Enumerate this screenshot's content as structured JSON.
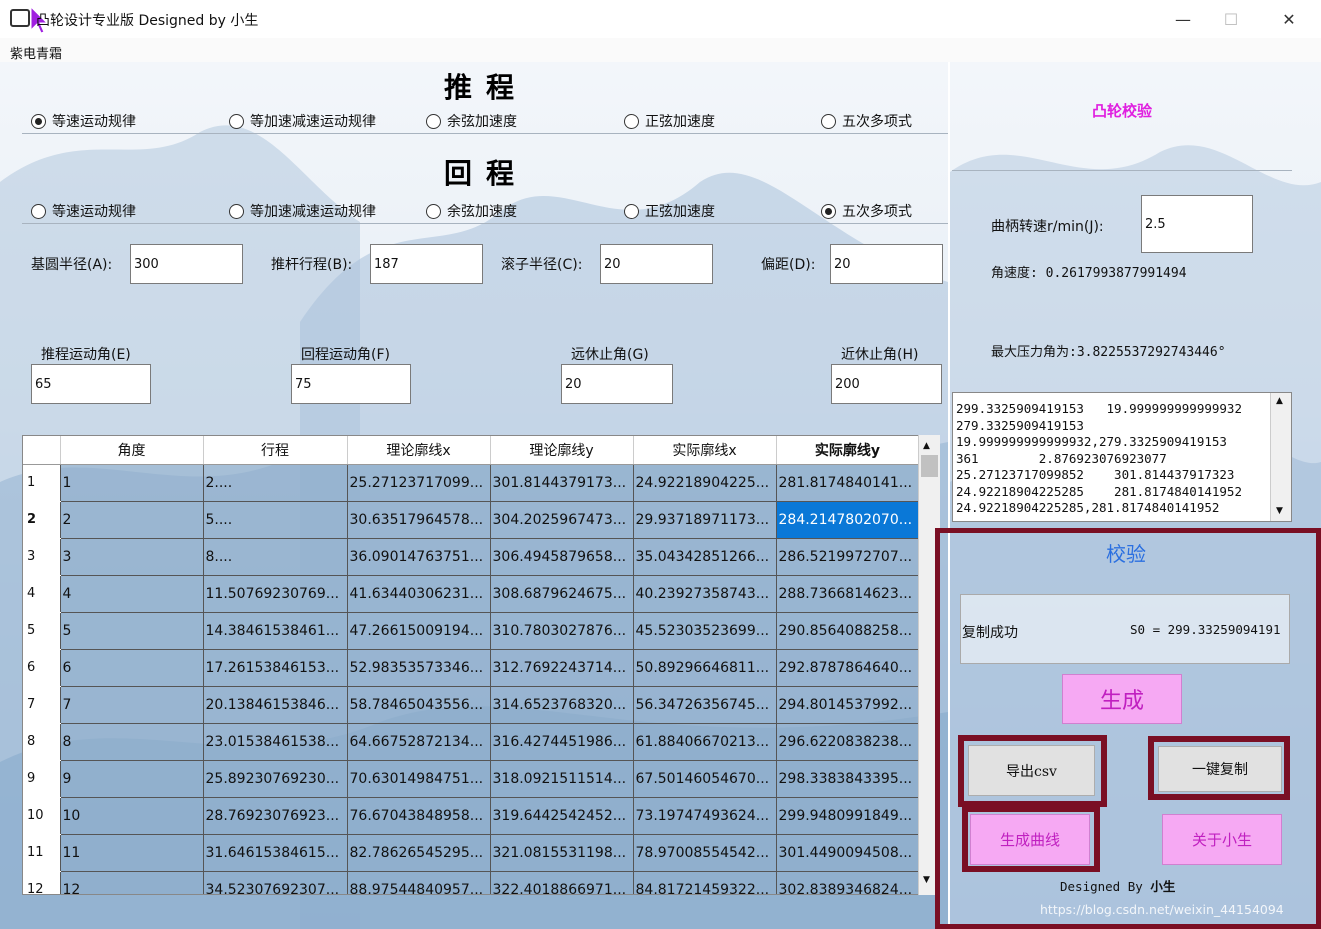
{
  "window": {
    "title": "凸轮设计专业版  Designed by 小生",
    "minimize": "—",
    "maximize": "☐",
    "close": "✕"
  },
  "menu": {
    "item": "紫电青霜"
  },
  "push": {
    "heading": "推程",
    "options": [
      "等速运动规律",
      "等加速减速运动规律",
      "余弦加速度",
      "正弦加速度",
      "五次多项式"
    ],
    "selected": 0
  },
  "return": {
    "heading": "回程",
    "options": [
      "等速运动规律",
      "等加速减速运动规律",
      "余弦加速度",
      "正弦加速度",
      "五次多项式"
    ],
    "selected": 4
  },
  "params": {
    "base_radius": {
      "label": "基圆半径(A):",
      "value": "300"
    },
    "stroke": {
      "label": "推杆行程(B):",
      "value": "187"
    },
    "roller_radius": {
      "label": "滚子半径(C):",
      "value": "20"
    },
    "offset": {
      "label": "偏距(D):",
      "value": "20"
    },
    "push_angle": {
      "label": "推程运动角(E)",
      "value": "65"
    },
    "return_angle": {
      "label": "回程运动角(F)",
      "value": "75"
    },
    "near_dwell": {
      "label": "远休止角(G)",
      "value": "20"
    },
    "far_dwell": {
      "label": "近休止角(H)",
      "value": "200"
    }
  },
  "table": {
    "columns": [
      "角度",
      "行程",
      "理论廓线x",
      "理论廓线y",
      "实际廓线x",
      "实际廓线y"
    ],
    "rows": [
      [
        "1",
        "1",
        "2....",
        "25.27123717099...",
        "301.8144379173...",
        "24.92218904225...",
        "281.8174840141..."
      ],
      [
        "2",
        "2",
        "5....",
        "30.63517964578...",
        "304.2025967473...",
        "29.93718971173...",
        "284.2147802070..."
      ],
      [
        "3",
        "3",
        "8....",
        "36.09014763751...",
        "306.4945879658...",
        "35.04342851266...",
        "286.5219972707..."
      ],
      [
        "4",
        "4",
        "11.50769230769...",
        "41.63440306231...",
        "308.6879624675...",
        "40.23927358743...",
        "288.7366814623..."
      ],
      [
        "5",
        "5",
        "14.38461538461...",
        "47.26615009194...",
        "310.7803027876...",
        "45.52303523699...",
        "290.8564088258..."
      ],
      [
        "6",
        "6",
        "17.26153846153...",
        "52.98353573346...",
        "312.7692243714...",
        "50.89296646811...",
        "292.8787864640..."
      ],
      [
        "7",
        "7",
        "20.13846153846...",
        "58.78465043556...",
        "314.6523768320...",
        "56.34726356745...",
        "294.8014537992..."
      ],
      [
        "8",
        "8",
        "23.01538461538...",
        "64.66752872134...",
        "316.4274451986...",
        "61.88406670213...",
        "296.6220838238..."
      ],
      [
        "9",
        "9",
        "25.89230769230...",
        "70.63014984751...",
        "318.0921511514...",
        "67.50146054670...",
        "298.3383843395..."
      ],
      [
        "10",
        "10",
        "28.76923076923...",
        "76.67043848958...",
        "319.6442542452...",
        "73.19747493624...",
        "299.9480991849..."
      ],
      [
        "11",
        "11",
        "31.64615384615...",
        "82.78626545295...",
        "321.0815531198...",
        "78.97008554542...",
        "301.4490094508..."
      ],
      [
        "12",
        "12",
        "34.52307692307...",
        "88.97544840957...",
        "322.4018866971...",
        "84.81721459322...",
        "302.8389346824..."
      ]
    ],
    "selected_row": 1
  },
  "check": {
    "title": "凸轮校验",
    "speed_label": "曲柄转速r/min(J):",
    "speed_value": "2.5",
    "angular_speed": "角速度: 0.2617993877991494",
    "max_pressure_angle": "最大压力角为:3.8225537292743446°",
    "log_lines": [
      "299.3325909419153   19.999999999999932",
      "279.3325909419153",
      "19.999999999999932,279.3325909419153",
      "361        2.876923076923077",
      "25.27123717099852    301.814437917323",
      "24.92218904225285    281.8174840141952",
      "24.92218904225285,281.8174840141952"
    ]
  },
  "verify": {
    "title": "校验",
    "status": "复制成功",
    "s0": "S0 = 299.33259094191",
    "generate": "生成",
    "export_csv": "导出csv",
    "copy_all": "一键复制",
    "generate_curve": "生成曲线",
    "about": "关于小生",
    "footer_prefix": "Designed By",
    "footer_author": "小生"
  },
  "watermark": "https://blog.csdn.net/weixin_44154094",
  "colors": {
    "accent_pink": "#f6a9f3",
    "frame_red": "#7a0f24",
    "selection_blue": "#0a78d7"
  }
}
